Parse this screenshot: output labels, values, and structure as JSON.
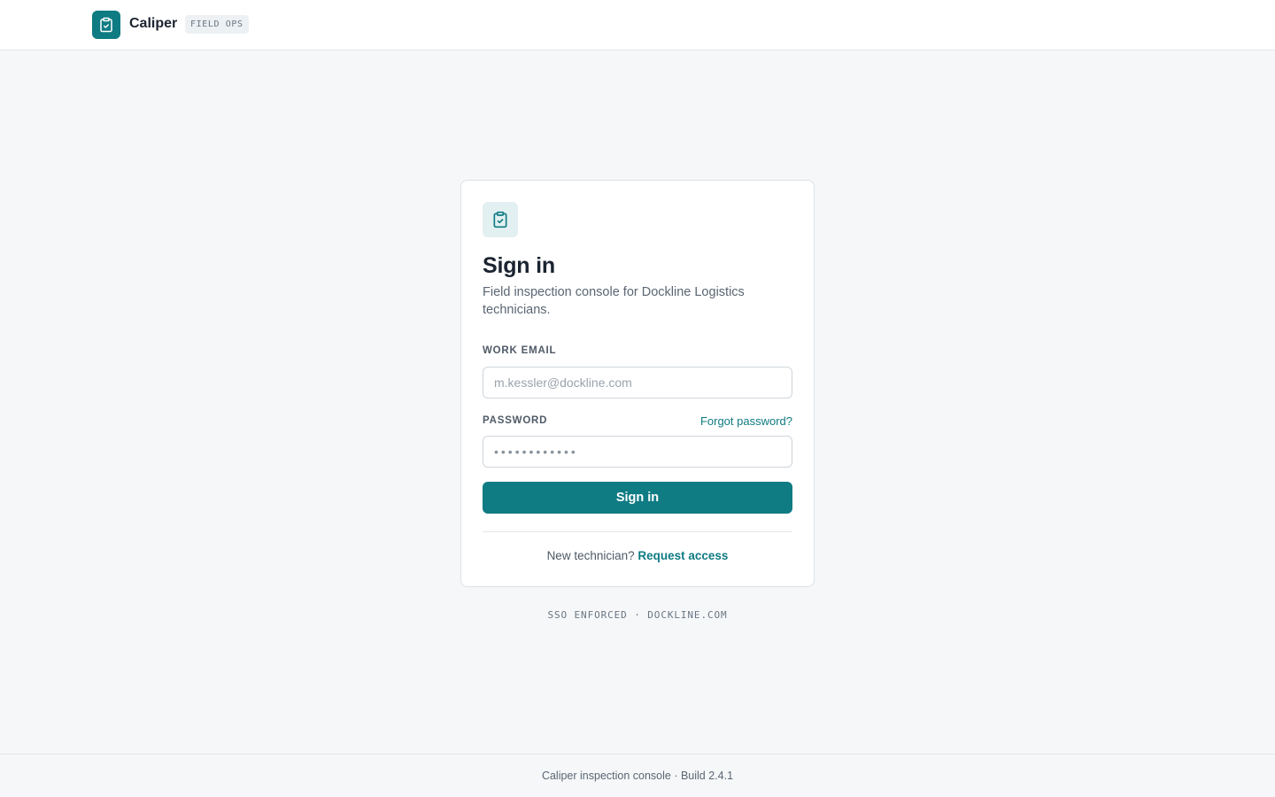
{
  "header": {
    "brand_name": "Caliper",
    "brand_tag": "FIELD OPS",
    "brand_icon": "clipboard-check-icon"
  },
  "card": {
    "icon": "clipboard-check-icon",
    "title": "Sign in",
    "subtitle": "Field inspection console for Dockline Logistics technicians.",
    "email_label": "WORK EMAIL",
    "email_placeholder": "m.kessler@dockline.com",
    "email_value": "",
    "password_label": "PASSWORD",
    "forgot_label": "Forgot password?",
    "password_placeholder": "••••••••••••",
    "signin_label": "Sign in",
    "new_prompt": "New technician?",
    "request_label": "Request access"
  },
  "sso_note": "SSO ENFORCED · DOCKLINE.COM",
  "footer": {
    "text": "Caliper inspection console · Build 2.4.1"
  },
  "colors": {
    "accent": "#0f7b83",
    "background": "#f5f7f9",
    "surface": "#ffffff"
  }
}
